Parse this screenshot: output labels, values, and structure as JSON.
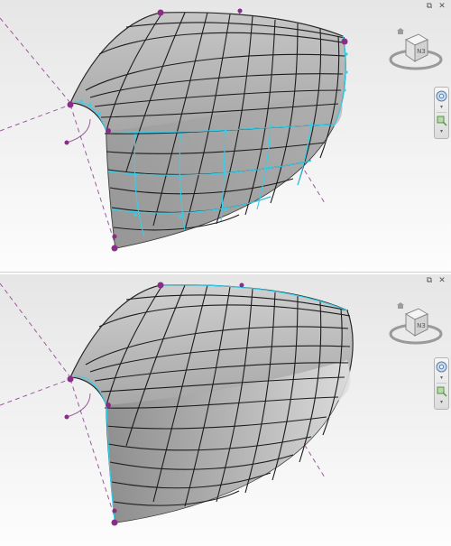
{
  "window_controls": {
    "restore_glyph": "⧉",
    "close_glyph": "✕"
  },
  "viewcube": {
    "face_label": "N3",
    "home_icon": "house-icon"
  },
  "nav_bar": {
    "tools": [
      "steering-wheel-icon",
      "zoom-region-icon"
    ],
    "arrow_glyph": "▾"
  },
  "viewports": [
    {
      "name": "top-view",
      "display_mode": "shaded with edit mesh",
      "edges_visible": true
    },
    {
      "name": "bottom-view",
      "display_mode": "shaded smooth surface",
      "edges_visible": true
    }
  ],
  "colors": {
    "surface": "#a9a9a9",
    "mesh_lines": "#222222",
    "control_points": "#32d0ec",
    "vertex_handles": "#8a2d8a",
    "reference_lines": "#9b5a9b",
    "background_top": "#e6e6e6",
    "background_bottom": "#fdfdfd"
  }
}
